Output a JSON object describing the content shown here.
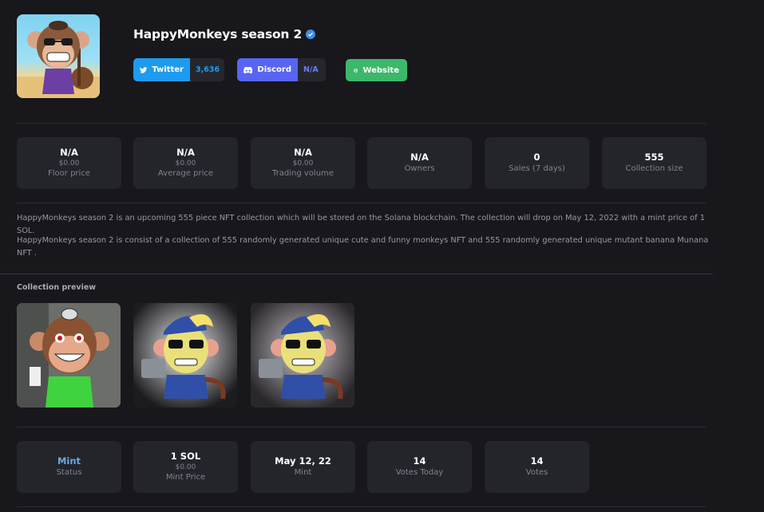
{
  "collection": {
    "title": "HappyMonkeys season 2",
    "verified": true
  },
  "socials": {
    "twitter_label": "Twitter",
    "twitter_count": "3,636",
    "discord_label": "Discord",
    "discord_count": "N/A",
    "website_label": "Website"
  },
  "stats": [
    {
      "value": "N/A",
      "sub": "$0.00",
      "label": "Floor price"
    },
    {
      "value": "N/A",
      "sub": "$0.00",
      "label": "Average price"
    },
    {
      "value": "N/A",
      "sub": "$0.00",
      "label": "Trading volume"
    },
    {
      "value": "N/A",
      "label": "Owners"
    },
    {
      "value": "0",
      "label": "Sales (7 days)"
    },
    {
      "value": "555",
      "label": "Collection size"
    }
  ],
  "description": {
    "p1": "HappyMonkeys season 2 is an upcoming 555 piece NFT collection which will be stored on the Solana blockchain. The collection will drop on May 12, 2022 with a mint price of 1 SOL.",
    "p2": "HappyMonkeys season 2 is consist of a collection of 555 randomly generated unique cute and funny monkeys NFT and 555 randomly generated unique mutant banana Munana NFT ."
  },
  "preview": {
    "title": "Collection preview"
  },
  "mint_stats": [
    {
      "value": "Mint",
      "label": "Status"
    },
    {
      "value": "1 SOL",
      "sub": "$0.00",
      "label": "Mint Price"
    },
    {
      "value": "May 12, 22",
      "label": "Mint"
    },
    {
      "value": "14",
      "label": "Votes Today"
    },
    {
      "value": "14",
      "label": "Votes"
    }
  ],
  "colors": {
    "background": "#18171c",
    "card": "#23252a",
    "twitter": "#1d9bf0",
    "discord": "#5865f2",
    "website": "#3cb86a",
    "status_mint": "#6fa8dc"
  }
}
